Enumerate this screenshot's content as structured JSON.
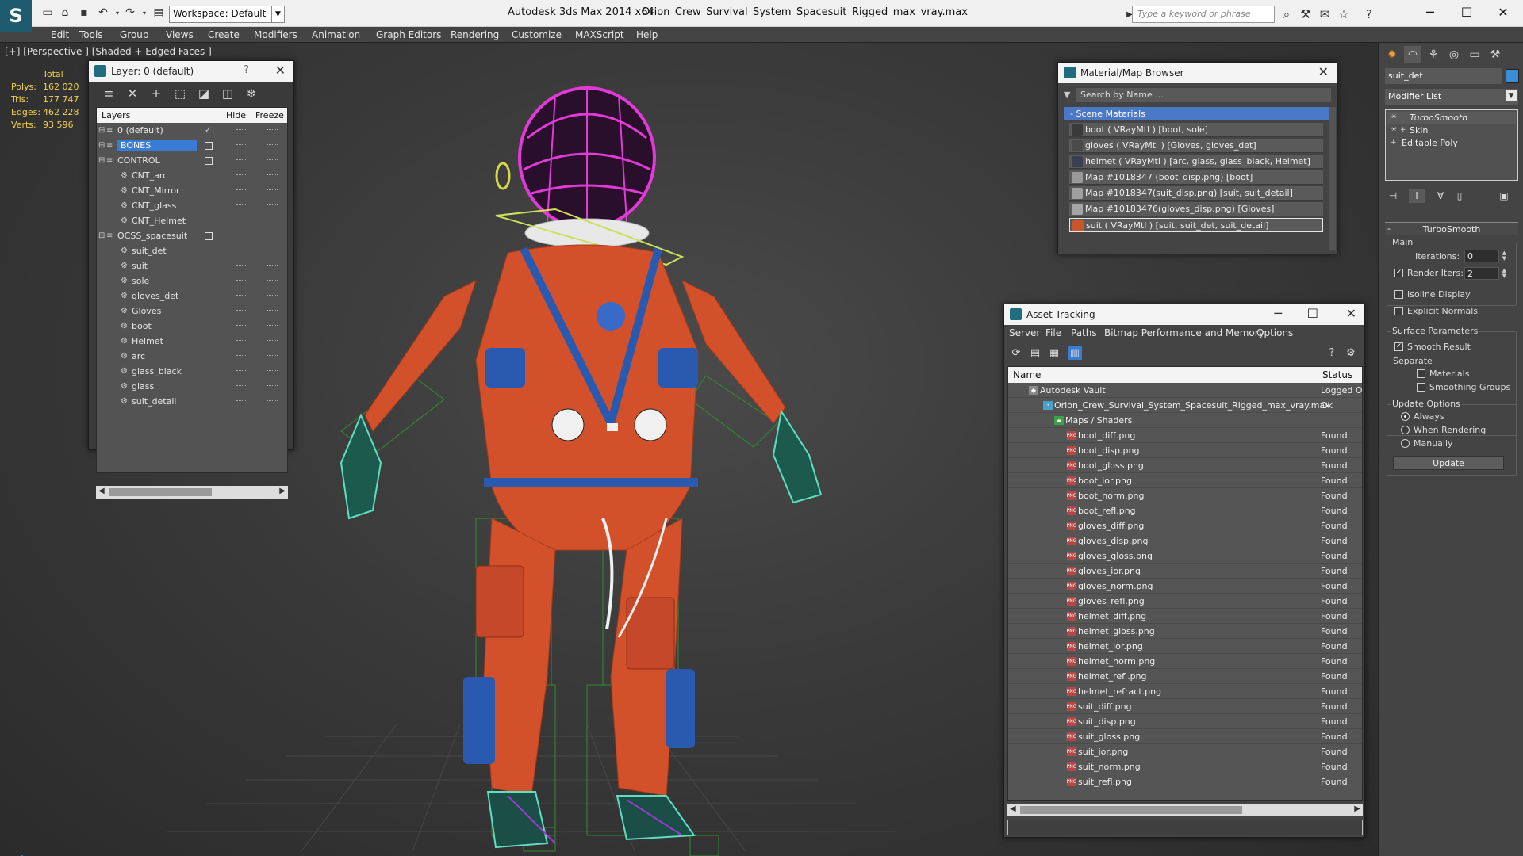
{
  "titlebar": {
    "app_title": "Autodesk 3ds Max  2014 x64",
    "document": "Orion_Crew_Survival_System_Spacesuit_Rigged_max_vray.max",
    "workspace": "Workspace: Default",
    "search_placeholder": "Type a keyword or phrase"
  },
  "menu": [
    "Edit",
    "Tools",
    "Group",
    "Views",
    "Create",
    "Modifiers",
    "Animation",
    "Graph Editors",
    "Rendering",
    "Customize",
    "MAXScript",
    "Help"
  ],
  "viewport": {
    "label": "[+] [Perspective ] [Shaded + Edged Faces ]",
    "stats_header": "Total",
    "stats": [
      {
        "k": "Polys:",
        "v": "162 020"
      },
      {
        "k": "Tris:",
        "v": "177 747"
      },
      {
        "k": "Edges:",
        "v": "462 228"
      },
      {
        "k": "Verts:",
        "v": "93 596"
      }
    ]
  },
  "layer_panel": {
    "title": "Layer: 0 (default)",
    "help": "?",
    "col_layers": "Layers",
    "col_hide": "Hide",
    "col_freeze": "Freeze",
    "rows": [
      {
        "name": "0 (default)",
        "indent": 0
      },
      {
        "name": "BONES",
        "indent": 0
      },
      {
        "name": "CONTROL",
        "indent": 0
      },
      {
        "name": "CNT_arc",
        "indent": 1
      },
      {
        "name": "CNT_Mirror",
        "indent": 1
      },
      {
        "name": "CNT_glass",
        "indent": 1
      },
      {
        "name": "CNT_Helmet",
        "indent": 1
      },
      {
        "name": "OCSS_spacesuit",
        "indent": 0
      },
      {
        "name": "suit_det",
        "indent": 1
      },
      {
        "name": "suit",
        "indent": 1
      },
      {
        "name": "sole",
        "indent": 1
      },
      {
        "name": "gloves_det",
        "indent": 1
      },
      {
        "name": "Gloves",
        "indent": 1
      },
      {
        "name": "boot",
        "indent": 1
      },
      {
        "name": "Helmet",
        "indent": 1
      },
      {
        "name": "arc",
        "indent": 1
      },
      {
        "name": "glass_black",
        "indent": 1
      },
      {
        "name": "glass",
        "indent": 1
      },
      {
        "name": "suit_detail",
        "indent": 1
      }
    ]
  },
  "material_browser": {
    "title": "Material/Map Browser",
    "search_placeholder": "Search by Name ...",
    "section": "- Scene Materials",
    "items": [
      {
        "label": "boot  ( VRayMtl ) [boot, sole]",
        "color": "#3a3a3a"
      },
      {
        "label": "gloves  ( VRayMtl ) [Gloves, gloves_det]",
        "color": "#4a4a4a"
      },
      {
        "label": "helmet  ( VRayMtl ) [arc, glass, glass_black, Helmet]",
        "color": "#3a4050"
      },
      {
        "label": "Map #1018347 (boot_disp.png) [boot]",
        "color": "#9a9a9a"
      },
      {
        "label": "Map #1018347(suit_disp.png) [suit, suit_detail]",
        "color": "#a0a0a0"
      },
      {
        "label": "Map #10183476(gloves_disp.png) [Gloves]",
        "color": "#a5a5a5"
      },
      {
        "label": "suit  ( VRayMtl ) [suit, suit_det, suit_detail]",
        "color": "#c8562a"
      }
    ]
  },
  "asset_tracking": {
    "title": "Asset Tracking",
    "menu": [
      "Server",
      "File",
      "Paths",
      "Bitmap Performance and Memory",
      "Options"
    ],
    "col_name": "Name",
    "col_status": "Status",
    "rows": [
      {
        "name": "Autodesk Vault",
        "status": "Logged Out",
        "level": 0,
        "icon": "vault"
      },
      {
        "name": "Orion_Crew_Survival_System_Spacesuit_Rigged_max_vray.max",
        "status": "Ok",
        "level": 1,
        "icon": "max"
      },
      {
        "name": "Maps / Shaders",
        "status": "",
        "level": 2,
        "icon": "folder"
      },
      {
        "name": "boot_diff.png",
        "status": "Found",
        "level": 3,
        "icon": "png"
      },
      {
        "name": "boot_disp.png",
        "status": "Found",
        "level": 3,
        "icon": "png"
      },
      {
        "name": "boot_gloss.png",
        "status": "Found",
        "level": 3,
        "icon": "png"
      },
      {
        "name": "boot_ior.png",
        "status": "Found",
        "level": 3,
        "icon": "png"
      },
      {
        "name": "boot_norm.png",
        "status": "Found",
        "level": 3,
        "icon": "png"
      },
      {
        "name": "boot_refl.png",
        "status": "Found",
        "level": 3,
        "icon": "png"
      },
      {
        "name": "gloves_diff.png",
        "status": "Found",
        "level": 3,
        "icon": "png"
      },
      {
        "name": "gloves_disp.png",
        "status": "Found",
        "level": 3,
        "icon": "png"
      },
      {
        "name": "gloves_gloss.png",
        "status": "Found",
        "level": 3,
        "icon": "png"
      },
      {
        "name": "gloves_ior.png",
        "status": "Found",
        "level": 3,
        "icon": "png"
      },
      {
        "name": "gloves_norm.png",
        "status": "Found",
        "level": 3,
        "icon": "png"
      },
      {
        "name": "gloves_refl.png",
        "status": "Found",
        "level": 3,
        "icon": "png"
      },
      {
        "name": "helmet_diff.png",
        "status": "Found",
        "level": 3,
        "icon": "png"
      },
      {
        "name": "helmet_gloss.png",
        "status": "Found",
        "level": 3,
        "icon": "png"
      },
      {
        "name": "helmet_ior.png",
        "status": "Found",
        "level": 3,
        "icon": "png"
      },
      {
        "name": "helmet_norm.png",
        "status": "Found",
        "level": 3,
        "icon": "png"
      },
      {
        "name": "helmet_refl.png",
        "status": "Found",
        "level": 3,
        "icon": "png"
      },
      {
        "name": "helmet_refract.png",
        "status": "Found",
        "level": 3,
        "icon": "png"
      },
      {
        "name": "suit_diff.png",
        "status": "Found",
        "level": 3,
        "icon": "png"
      },
      {
        "name": "suit_disp.png",
        "status": "Found",
        "level": 3,
        "icon": "png"
      },
      {
        "name": "suit_gloss.png",
        "status": "Found",
        "level": 3,
        "icon": "png"
      },
      {
        "name": "suit_ior.png",
        "status": "Found",
        "level": 3,
        "icon": "png"
      },
      {
        "name": "suit_norm.png",
        "status": "Found",
        "level": 3,
        "icon": "png"
      },
      {
        "name": "suit_refl.png",
        "status": "Found",
        "level": 3,
        "icon": "png"
      }
    ]
  },
  "command_panel": {
    "object_name": "suit_det",
    "modifier_list": "Modifier List",
    "stack": [
      "TurboSmooth",
      "Skin",
      "Editable Poly"
    ],
    "rollout": "TurboSmooth",
    "main": "Main",
    "iterations_label": "Iterations:",
    "iterations": "0",
    "render_iters_label": "Render Iters:",
    "render_iters": "2",
    "isoline": "Isoline Display",
    "explicit": "Explicit Normals",
    "surface": "Surface Parameters",
    "smooth": "Smooth Result",
    "separate": "Separate",
    "materials": "Materials",
    "smoothing": "Smoothing Groups",
    "update_options": "Update Options",
    "always": "Always",
    "when_rendering": "When Rendering",
    "manually": "Manually",
    "update": "Update"
  },
  "colors": {
    "accent": "#3a7bd5",
    "suit": "#d2502a",
    "stats": "#f2d24b"
  }
}
